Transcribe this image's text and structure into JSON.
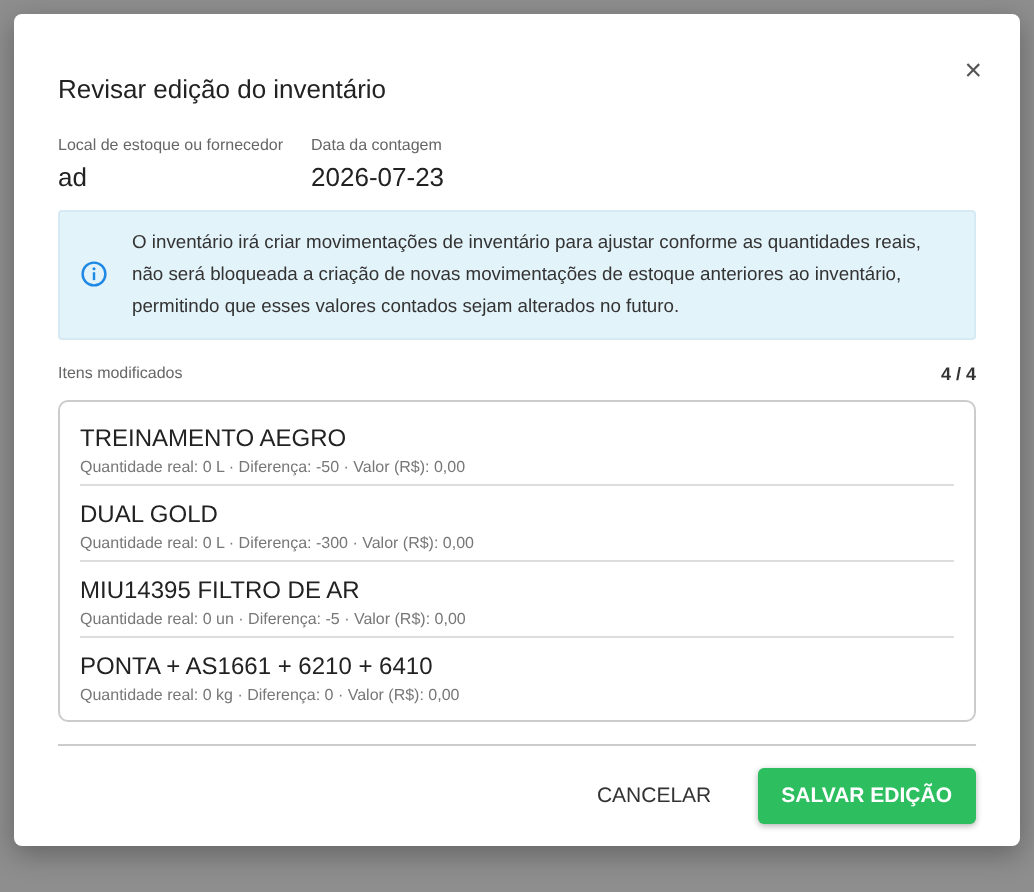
{
  "dialog": {
    "title": "Revisar edição do inventário",
    "close": "×",
    "fields": [
      {
        "label": "Local de estoque ou fornecedor",
        "value": "ad"
      },
      {
        "label": "Data da contagem",
        "value": "2026-07-23"
      }
    ],
    "info": "O inventário irá criar movimentações de inventário para ajustar conforme as quantidades reais, não será bloqueada a criação de novas movimentações de estoque anteriores ao inventário, permitindo que esses valores contados sejam alterados no futuro.",
    "list_label": "Itens modificados",
    "count": "4 / 4",
    "items": [
      {
        "name": "TREINAMENTO AEGRO",
        "details": "Quantidade real: 0 L · Diferença: -50 · Valor (R$): 0,00"
      },
      {
        "name": "DUAL GOLD",
        "details": "Quantidade real: 0 L · Diferença: -300 · Valor (R$): 0,00"
      },
      {
        "name": "MIU14395 FILTRO DE AR",
        "details": "Quantidade real: 0 un · Diferença: -5 · Valor (R$): 0,00"
      },
      {
        "name": "PONTA + AS1661 + 6210 + 6410",
        "details": "Quantidade real: 0 kg · Diferença: 0 · Valor (R$): 0,00"
      }
    ],
    "buttons": [
      {
        "label": "CANCELAR",
        "kind": "text"
      },
      {
        "label": "SALVAR EDIÇÃO",
        "kind": "primary"
      }
    ]
  }
}
